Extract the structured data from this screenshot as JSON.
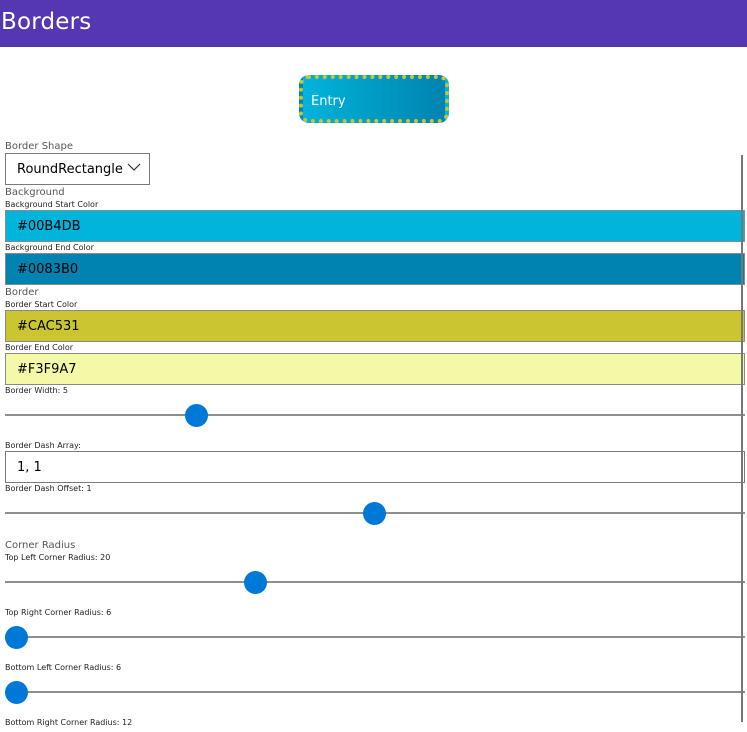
{
  "window": {
    "title": "Borders"
  },
  "preview": {
    "entry_label": "Entry"
  },
  "shape": {
    "label": "Border Shape",
    "value": "RoundRectangle"
  },
  "background": {
    "section": "Background",
    "start_label": "Background Start Color",
    "start_value": "#00B4DB",
    "end_label": "Background End Color",
    "end_value": "#0083B0"
  },
  "border": {
    "section": "Border",
    "start_label": "Border Start Color",
    "start_value": "#CAC531",
    "end_label": "Border End Color",
    "end_value": "#F3F9A7",
    "width_label": "Border Width: 5",
    "width_value": 5,
    "dash_array_label": "Border Dash Array:",
    "dash_array_value": "1, 1",
    "dash_offset_label": "Border Dash Offset: 1",
    "dash_offset_value": 1
  },
  "corner": {
    "section": "Corner Radius",
    "top_left_label": "Top Left Corner Radius: 20",
    "top_left_value": 20,
    "top_right_label": "Top Right Corner Radius: 6",
    "top_right_value": 6,
    "bottom_left_label": "Bottom Left Corner Radius: 6",
    "bottom_left_value": 6,
    "bottom_right_label": "Bottom Right Corner Radius: 12",
    "bottom_right_value": 12
  },
  "colors": {
    "titlebar": "#5537B3",
    "accent": "#0078D7",
    "bg_start": "#00B4DB",
    "bg_end": "#0083B0",
    "border_start": "#CAC531",
    "border_end": "#F3F9A7"
  }
}
